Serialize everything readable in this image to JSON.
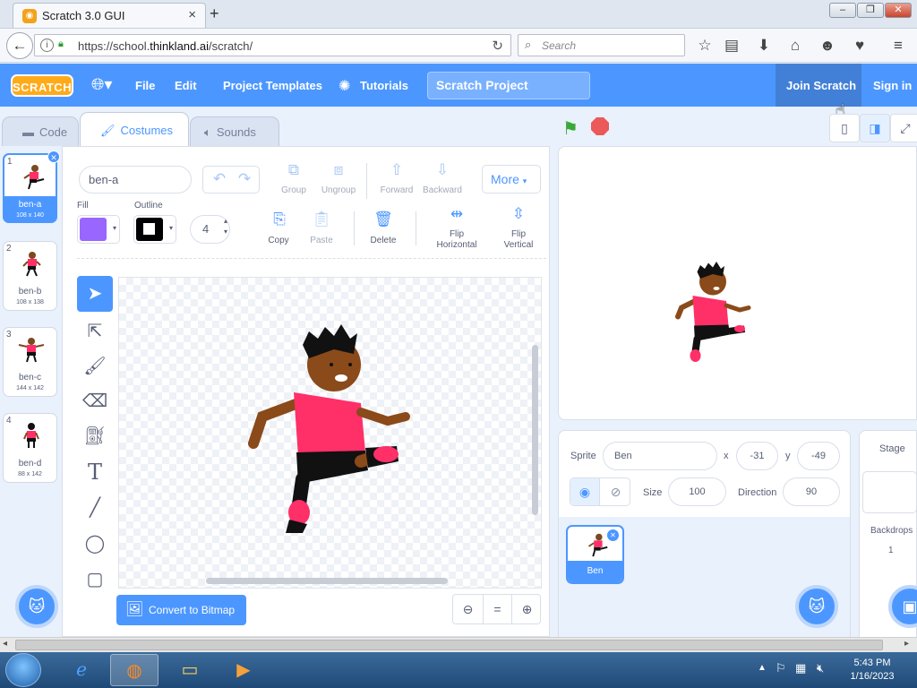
{
  "browser": {
    "tab_title": "Scratch 3.0 GUI",
    "tab_close": "×",
    "new_tab": "+",
    "url_plain": "https://school.",
    "url_domain": "thinkland.ai",
    "url_path": "/scratch/",
    "search_placeholder": "Search",
    "win_min": "–",
    "win_max": "❐",
    "win_close": "✕"
  },
  "menubar": {
    "logo": "SCRATCH",
    "file": "File",
    "edit": "Edit",
    "project_templates": "Project Templates",
    "tutorials": "Tutorials",
    "project_title": "Scratch Project",
    "join": "Join Scratch",
    "signin": "Sign in"
  },
  "tabs": {
    "code": "Code",
    "costumes": "Costumes",
    "sounds": "Sounds"
  },
  "costumes": [
    {
      "num": "1",
      "name": "ben-a",
      "size": "108 x 140"
    },
    {
      "num": "2",
      "name": "ben-b",
      "size": "108 x 138"
    },
    {
      "num": "3",
      "name": "ben-c",
      "size": "144 x 142"
    },
    {
      "num": "4",
      "name": "ben-d",
      "size": "88 x 142"
    }
  ],
  "paint": {
    "costume_name": "ben-a",
    "group": "Group",
    "ungroup": "Ungroup",
    "forward": "Forward",
    "backward": "Backward",
    "more": "More",
    "fill_label": "Fill",
    "outline_label": "Outline",
    "outline_width": "4",
    "copy": "Copy",
    "paste": "Paste",
    "delete": "Delete",
    "flip_h_1": "Flip",
    "flip_h_2": "Horizontal",
    "flip_v_1": "Flip",
    "flip_v_2": "Vertical",
    "convert": "Convert to Bitmap",
    "fill_color": "#9966ff",
    "outline_color": "#000000"
  },
  "sprite": {
    "label": "Sprite",
    "name": "Ben",
    "x_label": "x",
    "x": "-31",
    "y_label": "y",
    "y": "-49",
    "size_label": "Size",
    "size": "100",
    "direction_label": "Direction",
    "direction": "90",
    "tile_name": "Ben"
  },
  "stage_panel": {
    "title": "Stage",
    "backdrops_label": "Backdrops",
    "backdrops_count": "1"
  },
  "taskbar": {
    "time": "5:43 PM",
    "date": "1/16/2023"
  }
}
